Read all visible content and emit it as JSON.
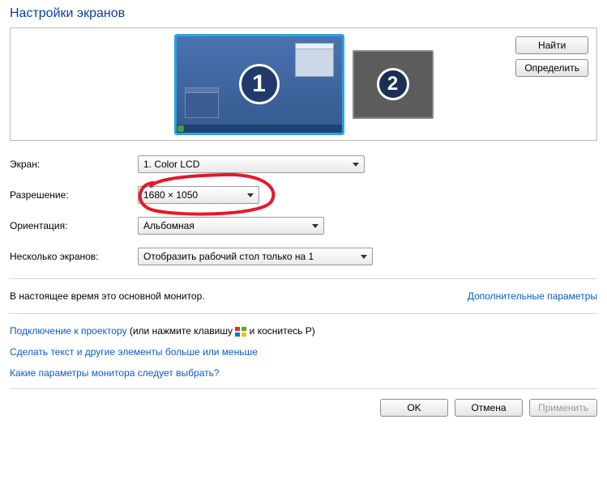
{
  "title": "Настройки экранов",
  "displays": {
    "n1": "1",
    "n2": "2"
  },
  "buttons": {
    "find": "Найти",
    "identify": "Определить",
    "ok": "OK",
    "cancel": "Отмена",
    "apply": "Применить"
  },
  "labels": {
    "screen": "Экран:",
    "resolution": "Разрешение:",
    "orientation": "Ориентация:",
    "multi": "Несколько экранов:"
  },
  "selects": {
    "screen": "1. Color LCD",
    "resolution": "1680 × 1050",
    "orientation": "Альбомная",
    "multi": "Отобразить рабочий стол только на 1"
  },
  "status": "В настоящее время это основной монитор.",
  "links": {
    "advanced": "Дополнительные параметры",
    "projector": "Подключение к проектору",
    "projector_hint_pre": " (или нажмите клавишу ",
    "projector_hint_post": " и коснитесь P)",
    "textsize": "Сделать текст и другие элементы больше или меньше",
    "which": "Какие параметры монитора следует выбрать?"
  }
}
